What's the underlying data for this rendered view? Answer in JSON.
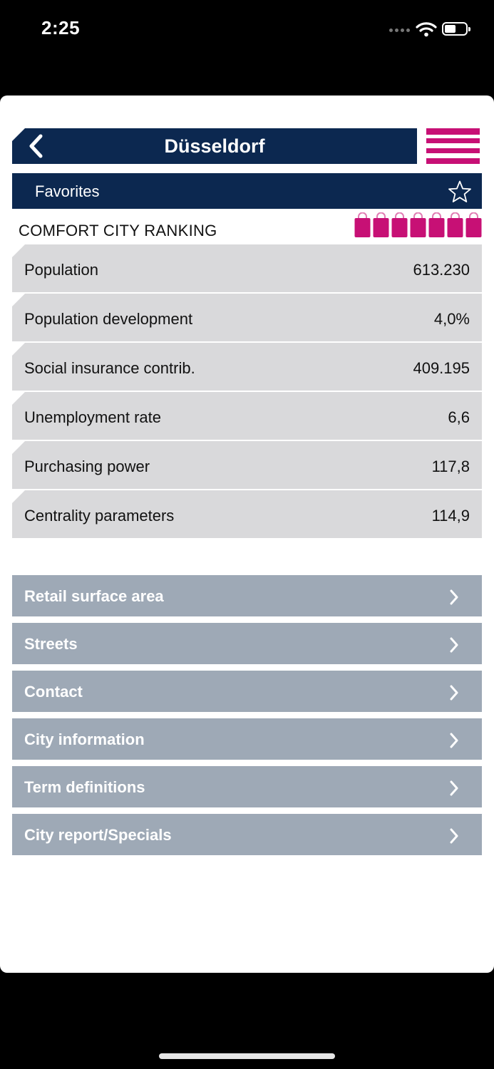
{
  "status_bar": {
    "time": "2:25"
  },
  "header": {
    "title": "Düsseldorf"
  },
  "favorites": {
    "label": "Favorites"
  },
  "ranking": {
    "label": "COMFORT CITY RANKING",
    "score": 7,
    "max": 7,
    "color": "#c71075"
  },
  "stats": [
    {
      "label": "Population",
      "value": "613.230"
    },
    {
      "label": "Population development",
      "value": "4,0%"
    },
    {
      "label": "Social insurance contrib.",
      "value": "409.195"
    },
    {
      "label": "Unemployment rate",
      "value": "6,6"
    },
    {
      "label": "Purchasing power",
      "value": "117,8"
    },
    {
      "label": "Centrality parameters",
      "value": "114,9"
    }
  ],
  "links": [
    {
      "label": "Retail surface area"
    },
    {
      "label": "Streets"
    },
    {
      "label": "Contact"
    },
    {
      "label": "City information"
    },
    {
      "label": "Term definitions"
    },
    {
      "label": "City report/Specials"
    }
  ],
  "colors": {
    "navy": "#0c2850",
    "magenta": "#c71075",
    "row_gray": "#d9d9db",
    "link_gray": "#9ea9b6"
  },
  "icons": [
    "back-arrow-icon",
    "hamburger-menu-icon",
    "star-outline-icon",
    "shopping-bag-icon",
    "chevron-right-icon",
    "wifi-icon",
    "battery-icon"
  ]
}
